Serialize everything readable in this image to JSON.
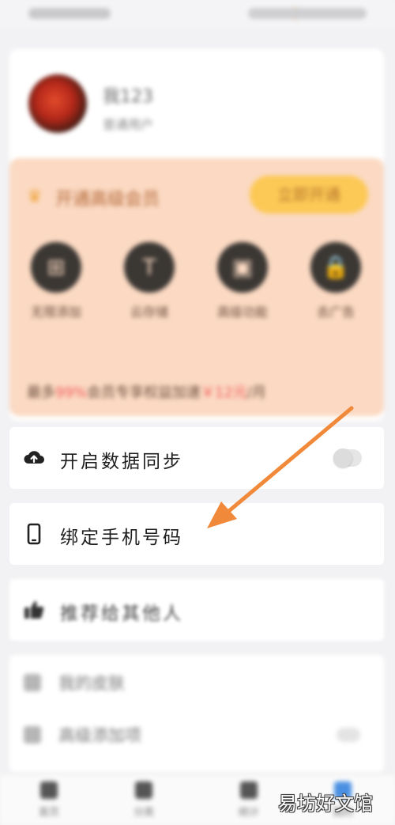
{
  "profile": {
    "username": "我123",
    "subtitle": "普通用户"
  },
  "vip": {
    "title": "开通高级会员",
    "button": "立即开通",
    "benefits": [
      {
        "label": "无限添加",
        "icon_text": "⊞"
      },
      {
        "label": "云存储",
        "icon_text": "T"
      },
      {
        "label": "高级功能",
        "icon_text": "▣"
      },
      {
        "label": "去广告",
        "icon_text": "🔒"
      }
    ],
    "footer_prefix": "最多",
    "footer_highlight_1": "99%",
    "footer_middle": "会员专享权益加速",
    "footer_highlight_2": "￥12元",
    "footer_suffix": "/月"
  },
  "menu": {
    "sync_label": "开启数据同步",
    "bind_phone_label": "绑定手机号码",
    "recommend_label": "推荐给其他人"
  },
  "extra": {
    "item1": "我的皮肤",
    "item2": "高级添加项"
  },
  "nav": {
    "items": [
      {
        "label": "首页"
      },
      {
        "label": "分类"
      },
      {
        "label": "统计"
      },
      {
        "label": "我的"
      }
    ]
  },
  "watermark": "易坊好文馆",
  "colors": {
    "accent_arrow": "#f08a3a",
    "vip_bg": "#fbd9c2",
    "vip_button": "#fcc956"
  }
}
